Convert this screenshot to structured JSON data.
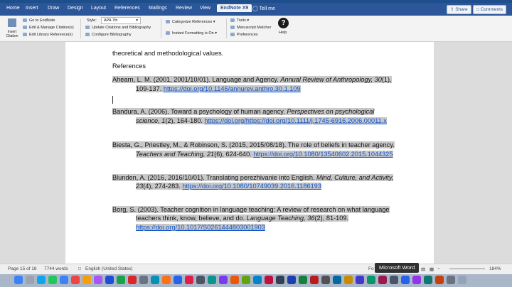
{
  "tabs": [
    "Home",
    "Insert",
    "Draw",
    "Design",
    "Layout",
    "References",
    "Mailings",
    "Review",
    "View",
    "EndNote X9"
  ],
  "tell_me": "Tell me",
  "share_label": "Share",
  "comments_label": "Comments",
  "ribbon": {
    "insert_citation": "Insert Citation",
    "go_to_endnote": "Go to EndNote",
    "edit_manage": "Edit & Manage Citation(s)",
    "edit_library": "Edit Library Reference(s)",
    "style_label": "Style:",
    "style_value": "APA 7th",
    "update_citations": "Update Citations and Bibliography",
    "configure_bibliography": "Configure Bibliography",
    "categorize": "Categorize References",
    "instant_formatting": "Instant Formatting is On",
    "tools": "Tools",
    "manuscript_matcher": "Manuscript Matcher",
    "preferences": "Preferences",
    "help": "Help"
  },
  "document": {
    "intro_line": "theoretical and methodological values.",
    "heading": "References",
    "refs": [
      {
        "pre": "Ahearn, L. M. (2001, 2001/10/01). Language and Agency. ",
        "ital": "Annual Review of Anthropology, 30",
        "post": "(1), 109-137. ",
        "url": "https://doi.org/10.1146/annurev.anthro.30.1.109"
      },
      {
        "pre": "Bandura, A. (2006). Toward a psychology of human agency. ",
        "ital": "Perspectives on psychological science, 1",
        "post": "(2), 164-180. ",
        "url": "https://doi.org/https://doi.org/10.1111/j.1745-6916.2006.00011.x"
      },
      {
        "pre": "Biesta, G., Priestley, M., & Robinson, S. (2015, 2015/08/18). The role of beliefs in teacher agency. ",
        "ital": "Teachers and Teaching, 21",
        "post": "(6), 624-640. ",
        "url": "https://doi.org/10.1080/13540602.2015.1044325"
      },
      {
        "pre": "Blunden, A. (2016, 2016/10/01). Translating perezhivanie into English. ",
        "ital": "Mind, Culture, and Activity, 23",
        "post": "(4), 274-283. ",
        "url": "https://doi.org/10.1080/10749039.2016.1186193"
      },
      {
        "pre": "Borg, S. (2003). Teacher cognition in language teaching: A review of research on what language teachers think, know, believe, and do. ",
        "ital": "Language Teaching, 36",
        "post": "(2), 81-109. ",
        "url": "https://doi.org/10.1017/S0261444803001903"
      }
    ]
  },
  "status": {
    "page": "Page 15 of 18",
    "words": "7744 words",
    "language": "English (United States)",
    "focus": "Fo",
    "zoom": "184%"
  },
  "tooltip": "Microsoft Word"
}
